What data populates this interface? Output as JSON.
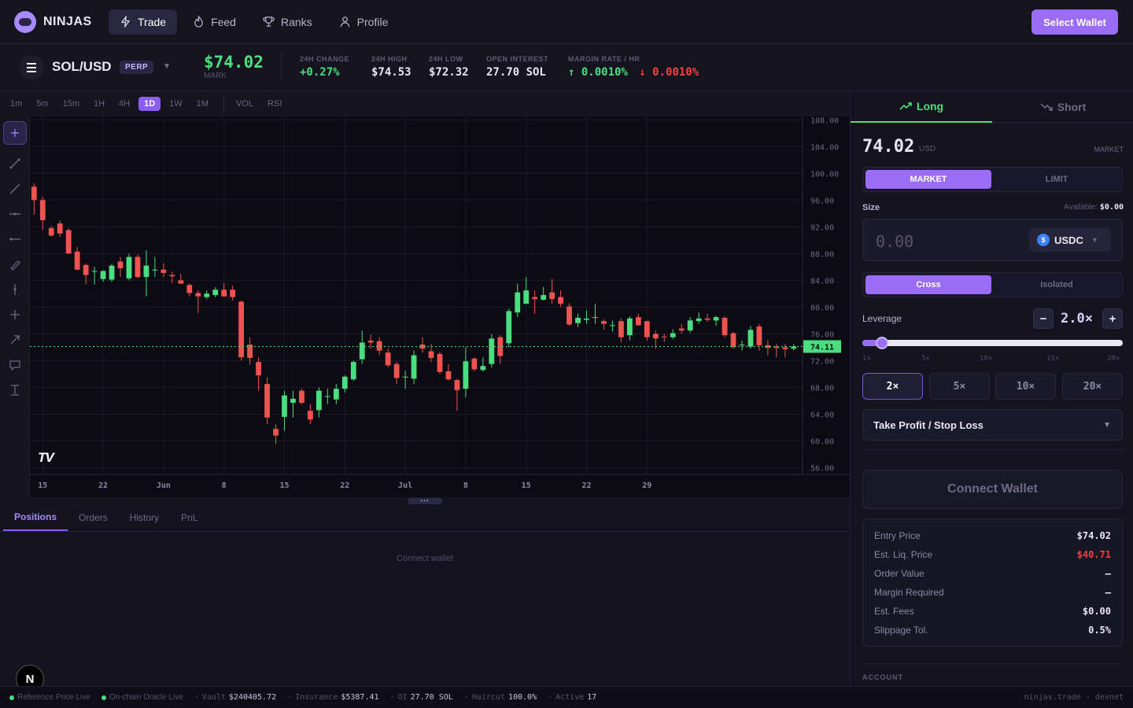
{
  "brand": {
    "name": "NINJAS"
  },
  "nav": [
    {
      "label": "Trade",
      "icon": "bolt-icon",
      "active": true
    },
    {
      "label": "Feed",
      "icon": "flame-icon",
      "active": false
    },
    {
      "label": "Ranks",
      "icon": "trophy-icon",
      "active": false
    },
    {
      "label": "Profile",
      "icon": "user-icon",
      "active": false
    }
  ],
  "header": {
    "select_wallet": "Select Wallet"
  },
  "market": {
    "pair": "SOL/USD",
    "badge": "PERP",
    "mark_price": "$74.02",
    "mark_label": "MARK",
    "stats": [
      {
        "label": "24H CHANGE",
        "value": "+0.27%",
        "color": "#4ade80"
      },
      {
        "label": "24H HIGH",
        "value": "$74.53",
        "color": "#e8e6f2"
      },
      {
        "label": "24H LOW",
        "value": "$72.32",
        "color": "#e8e6f2"
      },
      {
        "label": "OPEN INTEREST",
        "value": "27.70 SOL",
        "color": "#e8e6f2"
      }
    ],
    "margin_rate": {
      "label": "MARGIN RATE / HR",
      "long": "↑ 0.0010%",
      "short": "↓ 0.0010%",
      "long_color": "#4ade80",
      "short_color": "#ef4444"
    }
  },
  "chart_toolbar": {
    "timeframes": [
      "1m",
      "5m",
      "15m",
      "1H",
      "4H",
      "1D",
      "1W",
      "1M"
    ],
    "active_timeframe": "1D",
    "indicators": [
      "VOL",
      "RSI"
    ]
  },
  "chart_data": {
    "type": "candlestick",
    "x_tick_labels": [
      "15",
      "22",
      "Jun",
      "8",
      "15",
      "22",
      "Jul",
      "8",
      "15",
      "22",
      "29"
    ],
    "y_ticks": [
      108,
      104,
      100,
      96,
      92,
      88,
      84,
      80,
      76,
      72,
      68,
      64,
      60,
      56
    ],
    "ylim": [
      55,
      108.5
    ],
    "last_price": "74.11",
    "last_price_value": 74.11,
    "candles": [
      [
        98,
        96,
        98.5,
        93.8
      ],
      [
        96,
        93,
        96.5,
        91.5
      ],
      [
        91.8,
        90.7,
        92.1,
        90.5
      ],
      [
        92.5,
        91,
        93,
        90.5
      ],
      [
        91.5,
        88,
        91.8,
        88
      ],
      [
        88.3,
        85.6,
        89,
        85.5
      ],
      [
        86.3,
        84.8,
        86.5,
        83.4
      ],
      [
        85.4,
        85.4,
        86,
        83.4
      ],
      [
        84.2,
        85.4,
        85.5,
        83.8
      ],
      [
        84.1,
        86.2,
        86.5,
        83.8
      ],
      [
        86.8,
        85.8,
        87.5,
        84.5
      ],
      [
        84.3,
        87.5,
        88,
        84
      ],
      [
        87.5,
        84.5,
        87.9,
        84.3
      ],
      [
        84.5,
        86.2,
        88.5,
        81.6
      ],
      [
        85.6,
        85.6,
        87.5,
        84.5
      ],
      [
        85.6,
        85.1,
        86.5,
        84.5
      ],
      [
        84.8,
        84.6,
        85.3,
        83.6
      ],
      [
        84,
        83.5,
        85,
        83.5
      ],
      [
        83.3,
        82.1,
        83.5,
        81.6
      ],
      [
        82.1,
        81.6,
        82.5,
        79.1
      ],
      [
        81.5,
        82,
        82.5,
        81.2
      ],
      [
        81.8,
        82.6,
        83,
        81.5
      ],
      [
        82.6,
        81.6,
        83.6,
        81.6
      ],
      [
        82.6,
        81.5,
        83.2,
        81
      ],
      [
        80.8,
        72.5,
        81,
        72
      ],
      [
        74.4,
        72.4,
        75.5,
        71.4
      ],
      [
        71.8,
        69.8,
        72.5,
        67.5
      ],
      [
        68.5,
        63.5,
        69.5,
        62.5
      ],
      [
        61.8,
        60.8,
        62.5,
        59.5
      ],
      [
        63.6,
        66.8,
        67.5,
        61.5
      ],
      [
        65.7,
        66.3,
        67.5,
        63.5
      ],
      [
        67.5,
        65.7,
        67.8,
        65.5
      ],
      [
        64.5,
        63.2,
        65.5,
        62.5
      ],
      [
        64.6,
        67.5,
        68,
        63.5
      ],
      [
        66.6,
        66.7,
        67.8,
        65.5
      ],
      [
        66.2,
        67.8,
        68.5,
        65.5
      ],
      [
        67.8,
        69.6,
        69.8,
        67.2
      ],
      [
        69.2,
        71.8,
        72,
        69
      ],
      [
        72.2,
        74.7,
        76.5,
        71.5
      ],
      [
        75,
        74.7,
        75.9,
        73.8
      ],
      [
        74.9,
        73.5,
        75.5,
        72.8
      ],
      [
        73.2,
        71.3,
        73.8,
        71
      ],
      [
        71.5,
        69.4,
        71.8,
        68.5
      ],
      [
        69.6,
        69.6,
        70.5,
        67.8
      ],
      [
        69.3,
        72.8,
        73.5,
        68.5
      ],
      [
        74.4,
        73.8,
        75.5,
        73.2
      ],
      [
        73.4,
        72.4,
        74.5,
        71.8
      ],
      [
        73,
        70.3,
        73.3,
        70
      ],
      [
        70.4,
        69.2,
        71.5,
        69
      ],
      [
        69.1,
        67.6,
        69.3,
        64.5
      ],
      [
        67.8,
        71.9,
        74,
        66.5
      ],
      [
        72.3,
        70.7,
        72.5,
        70.4
      ],
      [
        70.6,
        71.2,
        72.5,
        70.4
      ],
      [
        71.5,
        75.3,
        76,
        71
      ],
      [
        75.5,
        72.7,
        75.8,
        71.5
      ],
      [
        74.6,
        79.4,
        79.8,
        74
      ],
      [
        79.2,
        82.2,
        83.5,
        78.5
      ],
      [
        80.5,
        82.5,
        84.5,
        80.5
      ],
      [
        81.5,
        81.2,
        82.5,
        79
      ],
      [
        81.1,
        81.8,
        83,
        81
      ],
      [
        82.2,
        81.2,
        84.2,
        80.5
      ],
      [
        81.5,
        80.5,
        82.5,
        80
      ],
      [
        80.1,
        77.4,
        80.6,
        77.2
      ],
      [
        77.6,
        78.4,
        79,
        77
      ],
      [
        78.1,
        78.3,
        79.5,
        77.5
      ],
      [
        78.5,
        78.5,
        80.5,
        77.5
      ],
      [
        77.9,
        77.5,
        78.2,
        76.6
      ],
      [
        77.3,
        77.3,
        78,
        76.4
      ],
      [
        77.9,
        75.5,
        78.3,
        74.7
      ],
      [
        75.8,
        78.3,
        78.6,
        75
      ],
      [
        78.5,
        77.3,
        79,
        77.2
      ],
      [
        77.9,
        75.5,
        78,
        75
      ],
      [
        76,
        75.3,
        76.5,
        73.8
      ],
      [
        75.6,
        75.5,
        76,
        74.8
      ],
      [
        75.5,
        76.1,
        76.7,
        75.2
      ],
      [
        76.8,
        76.5,
        77.5,
        76
      ],
      [
        76.5,
        78,
        78.5,
        76.2
      ],
      [
        77.9,
        78.3,
        79.2,
        77.5
      ],
      [
        78.3,
        78.1,
        79,
        77.8
      ],
      [
        78,
        78.5,
        78.7,
        77.2
      ],
      [
        78.4,
        75.8,
        78.6,
        75.5
      ],
      [
        76.1,
        74,
        76.3,
        73.8
      ],
      [
        74.3,
        74.4,
        75,
        73.5
      ],
      [
        74.1,
        76.6,
        77.2,
        73.8
      ],
      [
        77.1,
        74.3,
        77.5,
        73.5
      ],
      [
        74.3,
        73.9,
        75,
        72.8
      ],
      [
        74.1,
        73.9,
        74.5,
        72.5
      ],
      [
        74,
        73.7,
        74.5,
        72.5
      ],
      [
        73.8,
        74.11,
        74.5,
        73.5
      ]
    ]
  },
  "bottom": {
    "tabs": [
      "Positions",
      "Orders",
      "History",
      "PnL"
    ],
    "active": "Positions",
    "empty_message": "Connect wallet"
  },
  "order_panel": {
    "tabs": {
      "long": "Long",
      "short": "Short"
    },
    "price": "74.02",
    "price_unit": "USD",
    "price_mode": "MARKET",
    "order_types": [
      "MARKET",
      "LIMIT"
    ],
    "size_label": "Size",
    "available_label": "Available:",
    "available_value": "$0.00",
    "size_placeholder": "0.00",
    "collateral": "USDC",
    "margin_modes": [
      "Cross",
      "Isolated"
    ],
    "leverage_label": "Leverage",
    "leverage_value": "2.0×",
    "leverage_fraction": 0.0526,
    "leverage_ticks": [
      "1×",
      "5×",
      "10×",
      "15×",
      "20×"
    ],
    "presets": [
      "2×",
      "5×",
      "10×",
      "20×"
    ],
    "tpsl_label": "Take Profit / Stop Loss",
    "connect_label": "Connect Wallet",
    "summary": [
      {
        "k": "Entry Price",
        "v": "$74.02",
        "color": "#e8e6f2"
      },
      {
        "k": "Est. Liq. Price",
        "v": "$40.71",
        "color": "#ef4444"
      },
      {
        "k": "Order Value",
        "v": "—",
        "color": "#e8e6f2"
      },
      {
        "k": "Margin Required",
        "v": "—",
        "color": "#e8e6f2"
      },
      {
        "k": "Est. Fees",
        "v": "$0.00",
        "color": "#e8e6f2"
      },
      {
        "k": "Slippage Tol.",
        "v": "0.5%",
        "color": "#e8e6f2"
      }
    ],
    "account_label": "ACCOUNT"
  },
  "status_bar": {
    "ref_price": "Reference Price Live",
    "oracle": "On-chain Oracle Live",
    "vault_label": "Vault",
    "vault": "$240405.72",
    "insurance_label": "Insurance",
    "insurance": "$5387.41",
    "oi_label": "OI",
    "oi": "27.70 SOL",
    "haircut_label": "Haircut",
    "haircut": "100.0%",
    "active_label": "Active",
    "active": "17",
    "right": "ninjas.trade · devnet"
  },
  "colors": {
    "accent": "#9b6df5",
    "up": "#4ade80",
    "down": "#ef5350",
    "bg": "#14131f"
  }
}
